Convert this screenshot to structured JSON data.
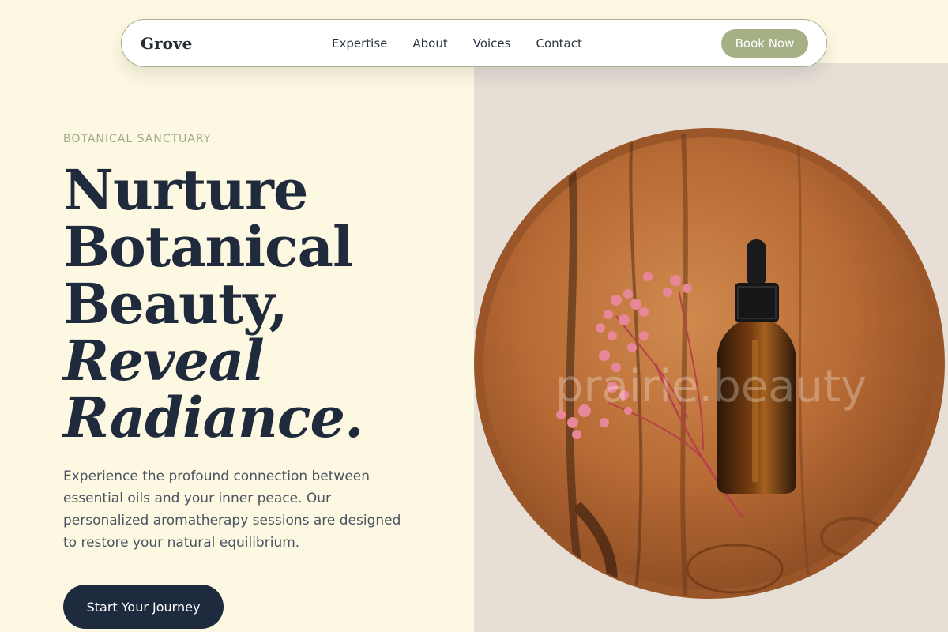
{
  "nav": {
    "brand": "Grove",
    "links": [
      "Expertise",
      "About",
      "Voices",
      "Contact"
    ],
    "cta": "Book Now"
  },
  "hero": {
    "eyebrow": "BOTANICAL SANCTUARY",
    "headline_lines": [
      "Nurture",
      "Botanical",
      "Beauty,"
    ],
    "headline_italic_lines": [
      "Reveal",
      "Radiance."
    ],
    "description": "Experience the profound connection between essential oils and your inner peace. Our personalized aromatherapy sessions are designed to restore your natural equilibrium.",
    "cta": "Start Your Journey"
  },
  "image": {
    "watermark": "prairie.beauty"
  },
  "colors": {
    "background": "#fdf8e1",
    "sage": "#a6b085",
    "navy": "#1e2a3e",
    "wood": "#b86b35"
  }
}
